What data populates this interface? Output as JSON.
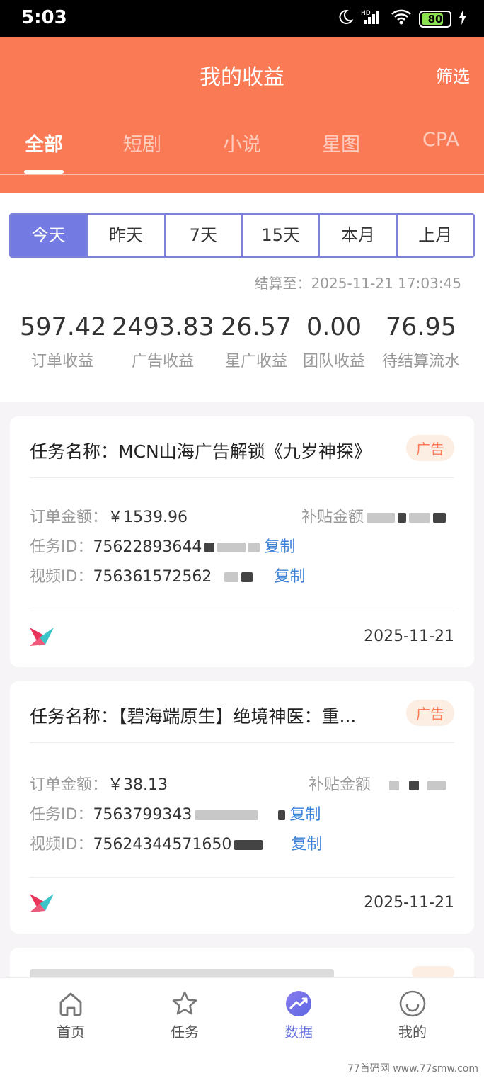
{
  "status": {
    "time": "5:03",
    "battery": "80",
    "battery_level": 0.8
  },
  "header": {
    "title": "我的收益",
    "filter": "筛选"
  },
  "tabs": [
    "全部",
    "短剧",
    "小说",
    "星图",
    "CPA"
  ],
  "periods": [
    "今天",
    "昨天",
    "7天",
    "15天",
    "本月",
    "上月"
  ],
  "settle_label": "结算至：2025-11-21 17:03:45",
  "stats": [
    {
      "value": "597.42",
      "label": "订单收益"
    },
    {
      "value": "2493.83",
      "label": "广告收益"
    },
    {
      "value": "26.57",
      "label": "星广收益"
    },
    {
      "value": "0.00",
      "label": "团队收益"
    },
    {
      "value": "76.95",
      "label": "待结算流水"
    }
  ],
  "cards": [
    {
      "name": "任务名称：MCN山海广告解锁《九岁神探》",
      "badge": "广告",
      "order_label": "订单金额：",
      "order_value": "￥1539.96",
      "subsidy_label": "补贴金额",
      "task_label": "任务ID：",
      "task_value": "75622893644",
      "video_label": "视频ID：",
      "video_value": "756361572562",
      "copy": "复制",
      "date": "2025-11-21"
    },
    {
      "name": "任务名称：【碧海端原生】绝境神医：重...",
      "badge": "广告",
      "order_label": "订单金额：",
      "order_value": "￥38.13",
      "subsidy_label": "补贴金额",
      "task_label": "任务ID：",
      "task_value": "7563799343",
      "video_label": "视频ID：",
      "video_value": "75624344571650",
      "copy": "复制",
      "date": "2025-11-21"
    }
  ],
  "nav": [
    {
      "label": "首页",
      "icon": "home-icon"
    },
    {
      "label": "任务",
      "icon": "star-icon"
    },
    {
      "label": "数据",
      "icon": "chart-icon"
    },
    {
      "label": "我的",
      "icon": "smile-icon"
    }
  ],
  "watermark": "77首码网 www.77smw.com",
  "colors": {
    "accent": "#fb7a56",
    "period_active": "#737be3",
    "nav_active": "#6a72e0",
    "copy": "#3c82d8"
  }
}
